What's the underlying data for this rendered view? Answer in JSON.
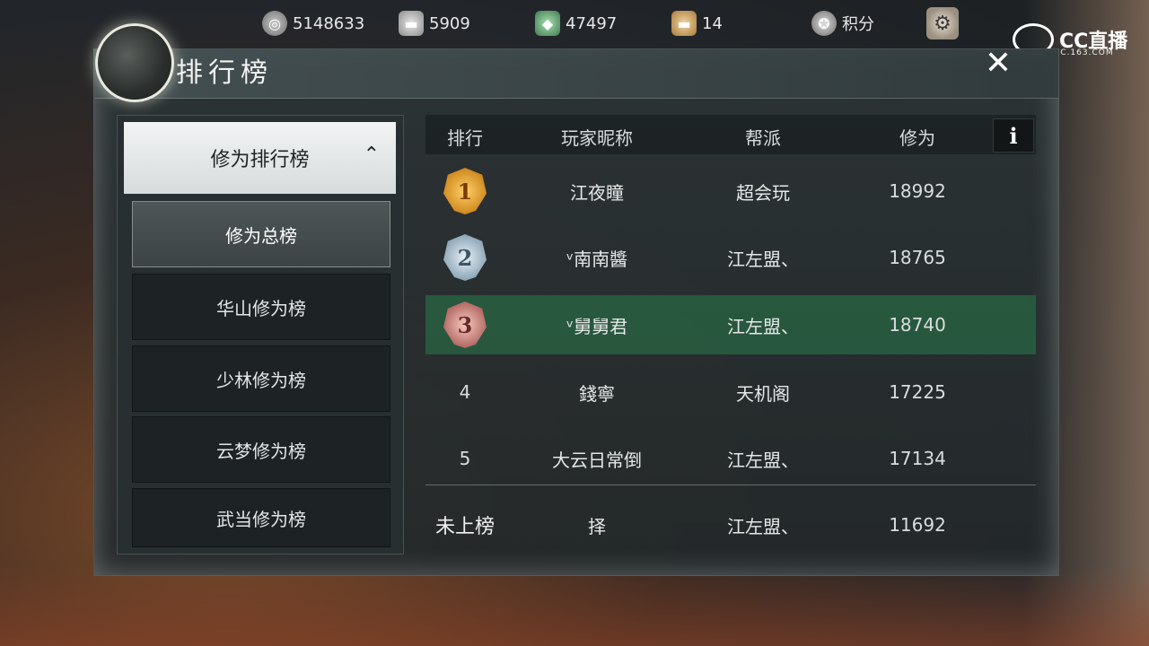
{
  "topbar": {
    "resources": [
      {
        "icon": "film-reel-coin-icon",
        "value": "5148633"
      },
      {
        "icon": "silver-ingot-icon",
        "value": "5909"
      },
      {
        "icon": "jade-icon",
        "value": "47497"
      },
      {
        "icon": "gold-ingot-icon",
        "value": "14"
      }
    ],
    "points_label": "积分",
    "points_icon": "points-badge-icon",
    "settings_icon": "gear-icon"
  },
  "watermark": {
    "brand": "CC直播",
    "sub": "CC.163.COM"
  },
  "panel": {
    "title": "排行榜",
    "close_icon": "close-icon"
  },
  "sidebar": {
    "category": "修为排行榜",
    "items": [
      {
        "label": "修为总榜",
        "active": true
      },
      {
        "label": "华山修为榜",
        "active": false
      },
      {
        "label": "少林修为榜",
        "active": false
      },
      {
        "label": "云梦修为榜",
        "active": false
      },
      {
        "label": "武当修为榜",
        "active": false
      }
    ]
  },
  "table": {
    "headers": [
      "排行",
      "玩家昵称",
      "帮派",
      "修为"
    ],
    "info_label": "i",
    "rows": [
      {
        "rank": "1",
        "name": "江夜瞳",
        "guild": "超会玩",
        "score": "18992"
      },
      {
        "rank": "2",
        "name": "ᵛ南南醬",
        "guild": "江左盟、",
        "score": "18765"
      },
      {
        "rank": "3",
        "name": "ᵛ舅舅君",
        "guild": "江左盟、",
        "score": "18740"
      },
      {
        "rank": "4",
        "name": "錢寧",
        "guild": "天机阁",
        "score": "17225"
      },
      {
        "rank": "5",
        "name": "大云日常倒",
        "guild": "江左盟、",
        "score": "17134"
      }
    ],
    "self_row": {
      "rank": "未上榜",
      "name": "择",
      "guild": "江左盟、",
      "score": "11692"
    }
  },
  "colors": {
    "highlight_row": "#2f7a4a",
    "panel_bg": "#2c3436",
    "active_tab": "#eef1f1"
  }
}
